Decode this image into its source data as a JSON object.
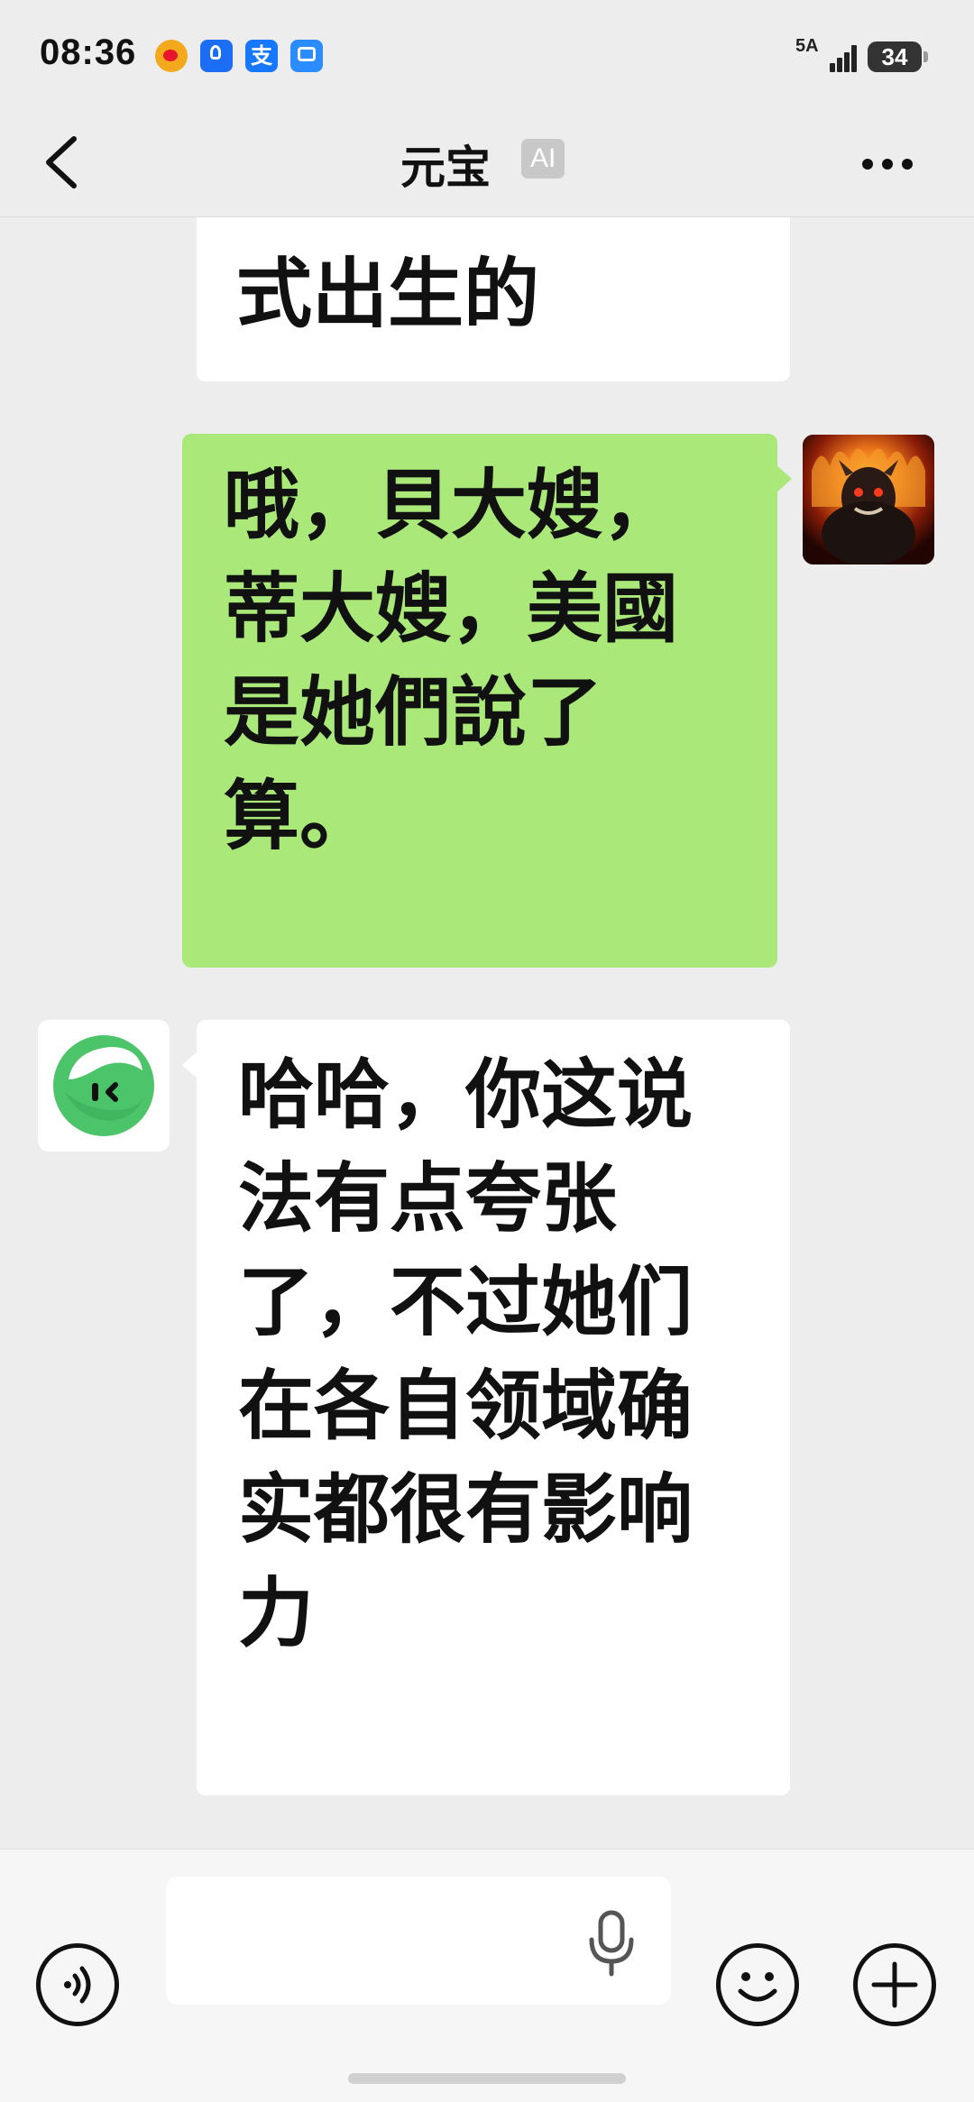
{
  "status_bar": {
    "time": "08:36",
    "network": "5A",
    "battery": "34",
    "notification_icons": [
      "weibo-icon",
      "bulb-icon",
      "alipay-icon",
      "app-icon"
    ],
    "alipay_glyph": "支"
  },
  "header": {
    "title": "元宝",
    "badge": "AI",
    "back_icon": "chevron-left-icon",
    "more_icon": "more-dots-icon"
  },
  "messages": [
    {
      "sender": "ai",
      "text": "式出生的",
      "partial": true
    },
    {
      "sender": "user",
      "text": "哦，貝大嫂，蒂大嫂，美國是她們說了算。"
    },
    {
      "sender": "ai",
      "text": "哈哈，你这说法有点夸张了，不过她们在各自领域确实都很有影响力"
    }
  ],
  "input_bar": {
    "placeholder": "",
    "value": "",
    "voice_icon": "voice-icon",
    "mic_icon": "microphone-icon",
    "emoji_icon": "emoji-icon",
    "plus_icon": "plus-icon"
  },
  "colors": {
    "background": "#ededed",
    "user_bubble": "#a9e879",
    "ai_bubble": "#ffffff",
    "ai_avatar_green": "#4cc46a"
  }
}
